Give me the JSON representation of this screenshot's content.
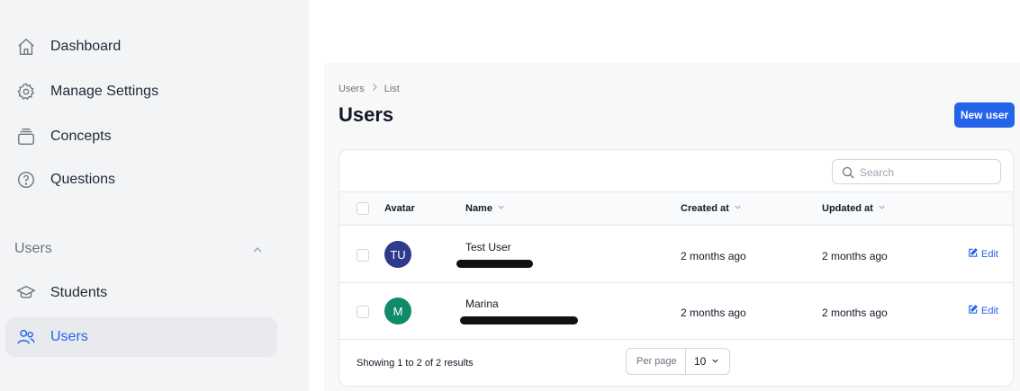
{
  "sidebar": {
    "items": [
      {
        "label": "Dashboard",
        "icon": "home-icon"
      },
      {
        "label": "Manage Settings",
        "icon": "gear-icon"
      },
      {
        "label": "Concepts",
        "icon": "stack-icon"
      },
      {
        "label": "Questions",
        "icon": "question-icon"
      }
    ],
    "group": {
      "label": "Users",
      "expanded": true,
      "items": [
        {
          "label": "Students",
          "icon": "graduation-cap-icon"
        },
        {
          "label": "Users",
          "icon": "users-icon",
          "active": true
        }
      ]
    }
  },
  "main": {
    "breadcrumb": [
      "Users",
      "List"
    ],
    "title": "Users",
    "new_user_label": "New user",
    "search_placeholder": "Search",
    "columns": [
      "Avatar",
      "Name",
      "Created at",
      "Updated at"
    ],
    "rows": [
      {
        "initials": "TU",
        "avatar_color": "#2e3a8c",
        "name": "Test User",
        "created": "2 months ago",
        "updated": "2 months ago",
        "action": "Edit"
      },
      {
        "initials": "M",
        "avatar_color": "#0f8a6b",
        "name": "Marina",
        "created": "2 months ago",
        "updated": "2 months ago",
        "action": "Edit"
      }
    ],
    "pagination": {
      "showing": "Showing 1 to 2 of 2 results",
      "per_page_label": "Per page",
      "per_page_value": "10"
    }
  },
  "colors": {
    "accent": "#2563eb"
  }
}
